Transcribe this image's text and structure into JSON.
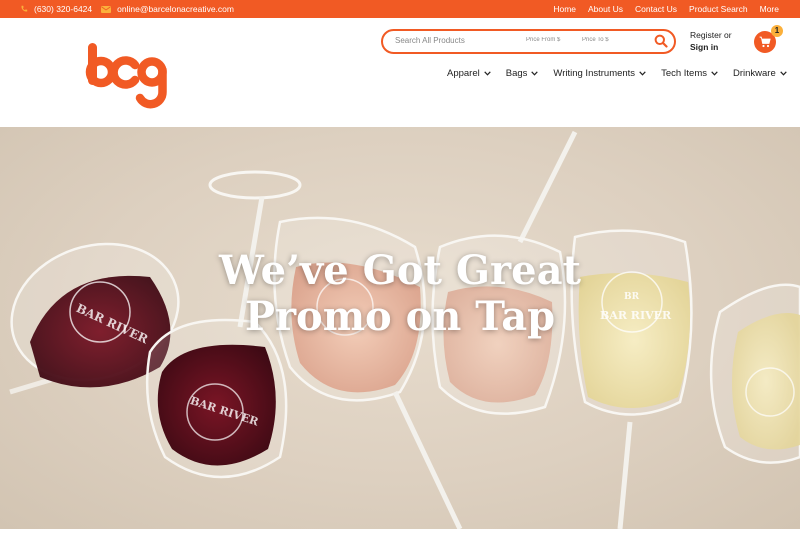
{
  "topbar": {
    "phone": "(630) 320-6424",
    "email": "online@barcelonacreative.com",
    "links": [
      "Home",
      "About Us",
      "Contact Us",
      "Product Search",
      "More"
    ]
  },
  "brand": {
    "logo_text": "bcg",
    "color": "#f15a24",
    "badge_color": "#fbb03b"
  },
  "search": {
    "query_placeholder": "Search All Products",
    "price_from_placeholder": "Price From $",
    "price_to_placeholder": "Price To $"
  },
  "account": {
    "register": "Register or",
    "signin": "Sign in"
  },
  "cart": {
    "count": "1"
  },
  "nav": {
    "items": [
      "Apparel",
      "Bags",
      "Writing Instruments",
      "Tech Items",
      "Drinkware"
    ]
  },
  "hero": {
    "headline_line1": "We’ve Got Great",
    "headline_line2": "Promo on Tap",
    "glass_label": "BAR RIVER",
    "glass_monogram": "BR"
  }
}
